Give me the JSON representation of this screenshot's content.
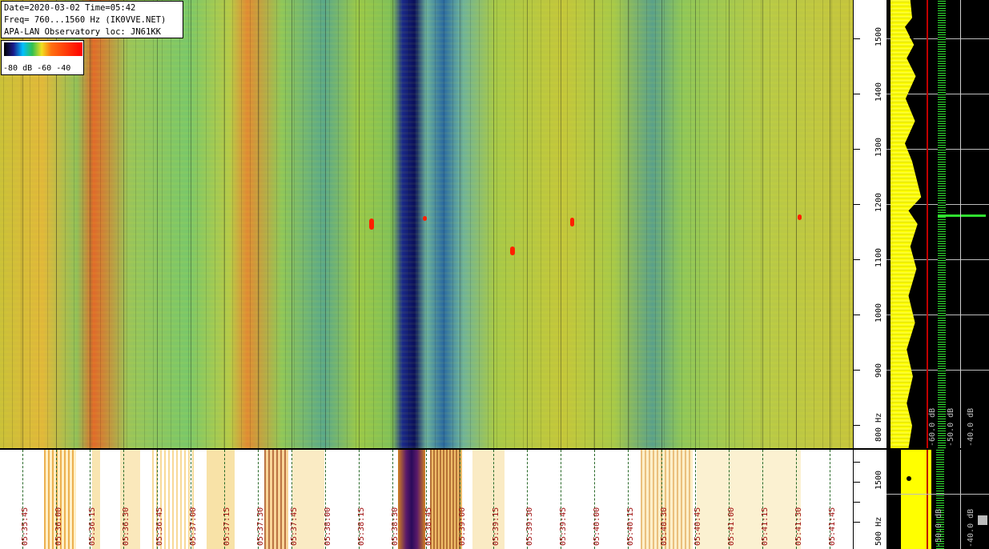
{
  "header": {
    "date_time": "Date=2020-03-02 Time=05:42",
    "freq": "Freq= 760...1560 Hz (IK0VVE.NET)",
    "observatory": "APA-LAN Observatory loc: JN61KK"
  },
  "legend": {
    "ticks": "-80 dB -60     -40"
  },
  "freq_axis": {
    "labels": [
      "1500",
      "1400",
      "1300",
      "1200",
      "1100",
      "1000",
      "900",
      "800 Hz"
    ]
  },
  "spectrum": {
    "db_labels": [
      "-60.0 dB",
      "-50.0 dB",
      "-40.0 dB"
    ]
  },
  "bottom_axis": {
    "labels": [
      "1500",
      "500 Hz"
    ],
    "db_labels": [
      "-50.0 dB",
      "-40.0 dB"
    ]
  },
  "time_axis": {
    "labels": [
      "05:35:45",
      "05:36:00",
      "05:36:15",
      "05:36:30",
      "05:36:45",
      "05:37:00",
      "05:37:15",
      "05:37:30",
      "05:37:45",
      "05:38:00",
      "05:38:15",
      "05:38:30",
      "05:38:45",
      "05:39:00",
      "05:39:15",
      "05:39:30",
      "05:39:45",
      "05:40:00",
      "05:40:15",
      "05:40:30",
      "05:40:45",
      "05:41:00",
      "05:41:15",
      "05:41:30",
      "05:41:45"
    ]
  },
  "colors": {
    "info_bg": "#ffffff",
    "time_label": "#a01010",
    "spectrum_fill": "#ffff00",
    "spectrum_trace": "#30e030"
  }
}
